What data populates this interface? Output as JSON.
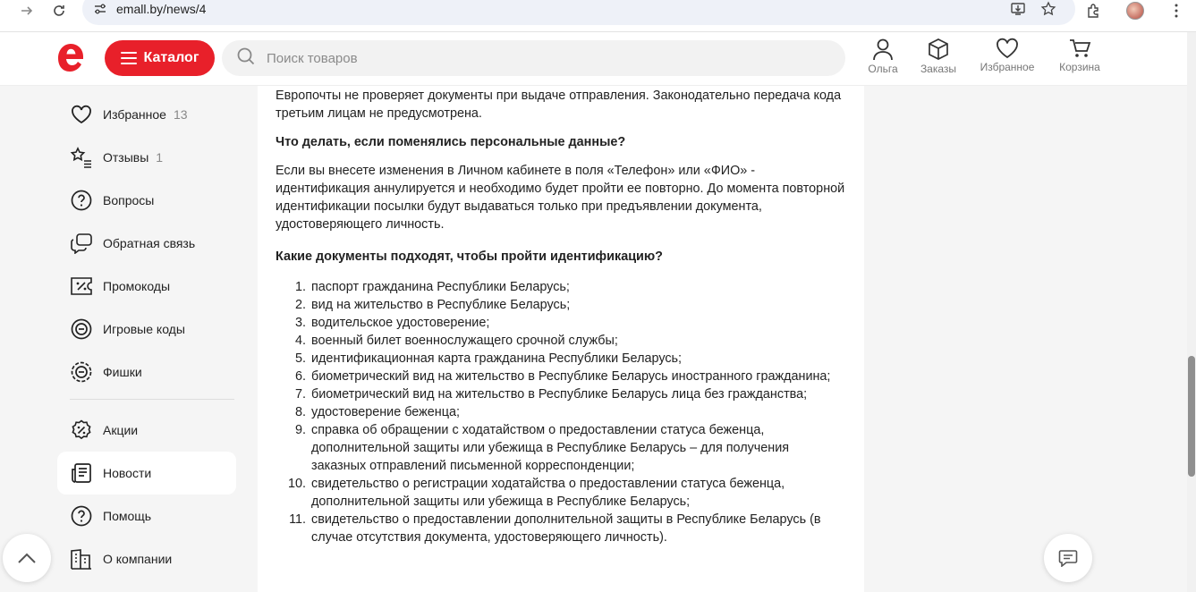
{
  "browser": {
    "url": "emall.by/news/4"
  },
  "header": {
    "catalog_label": "Каталог",
    "search_placeholder": "Поиск товаров",
    "actions": [
      {
        "label": "Ольга",
        "icon": "user-icon"
      },
      {
        "label": "Заказы",
        "icon": "box-icon"
      },
      {
        "label": "Избранное",
        "icon": "heart-icon"
      },
      {
        "label": "Корзина",
        "icon": "cart-icon"
      }
    ],
    "brand_color": "#e8202a"
  },
  "sidebar": {
    "items": [
      {
        "label": "Избранное",
        "count": "13",
        "icon": "heart-icon"
      },
      {
        "label": "Отзывы",
        "count": "1",
        "icon": "star-list-icon"
      },
      {
        "label": "Вопросы",
        "count": "",
        "icon": "question-icon"
      },
      {
        "label": "Обратная связь",
        "count": "",
        "icon": "feedback-icon"
      },
      {
        "label": "Промокоды",
        "count": "",
        "icon": "promo-icon"
      },
      {
        "label": "Игровые коды",
        "count": "",
        "icon": "game-code-icon"
      },
      {
        "label": "Фишки",
        "count": "",
        "icon": "chips-icon"
      },
      {
        "label": "Акции",
        "count": "",
        "icon": "discount-icon"
      },
      {
        "label": "Новости",
        "count": "",
        "icon": "news-icon",
        "active": true
      },
      {
        "label": "Помощь",
        "count": "",
        "icon": "help-icon"
      },
      {
        "label": "О компании",
        "count": "",
        "icon": "company-icon"
      }
    ]
  },
  "article": {
    "intro_text": "Европочты не проверяет документы при выдаче отправления. Законодательно передача кода третьим лицам не предусмотрена.",
    "heading_1": "Что делать, если поменялись персональные данные?",
    "paragraph_1": "Если вы внесете изменения в Личном кабинете в поля «Телефон» или «ФИО» - идентификация аннулируется и необходимо будет пройти ее повторно. До момента повторной идентификации посылки будут выдаваться только при предъявлении документа, удостоверяющего личность.",
    "heading_2": "Какие документы подходят, чтобы пройти идентификацию?",
    "documents": [
      {
        "num": "1.",
        "text": "паспорт гражданина Республики Беларусь;"
      },
      {
        "num": "2.",
        "text": "вид на жительство в Республике Беларусь;"
      },
      {
        "num": "3.",
        "text": "водительское удостоверение;"
      },
      {
        "num": "4.",
        "text": "военный билет военнослужащего срочной службы;"
      },
      {
        "num": "5.",
        "text": "идентификационная карта гражданина Республики Беларусь;"
      },
      {
        "num": "6.",
        "text": "биометрический вид на жительство в Республике Беларусь иностранного гражданина;"
      },
      {
        "num": "7.",
        "text": "биометрический вид на жительство в Республике Беларусь лица без гражданства;"
      },
      {
        "num": "8.",
        "text": "удостоверение беженца;"
      },
      {
        "num": "9.",
        "text": "справка об обращении с ходатайством о предоставлении статуса беженца, дополнительной защиты или убежища в Республике Беларусь – для получения заказных отправлений письменной корреспонденции;"
      },
      {
        "num": "10.",
        "text": "свидетельство о регистрации ходатайства о предоставлении статуса беженца, дополнительной защиты или убежища в Республике Беларусь;"
      },
      {
        "num": "11.",
        "text": "свидетельство о предоставлении дополнительной защиты в Республике Беларусь (в случае отсутствия документа, удостоверяющего личность)."
      }
    ]
  }
}
